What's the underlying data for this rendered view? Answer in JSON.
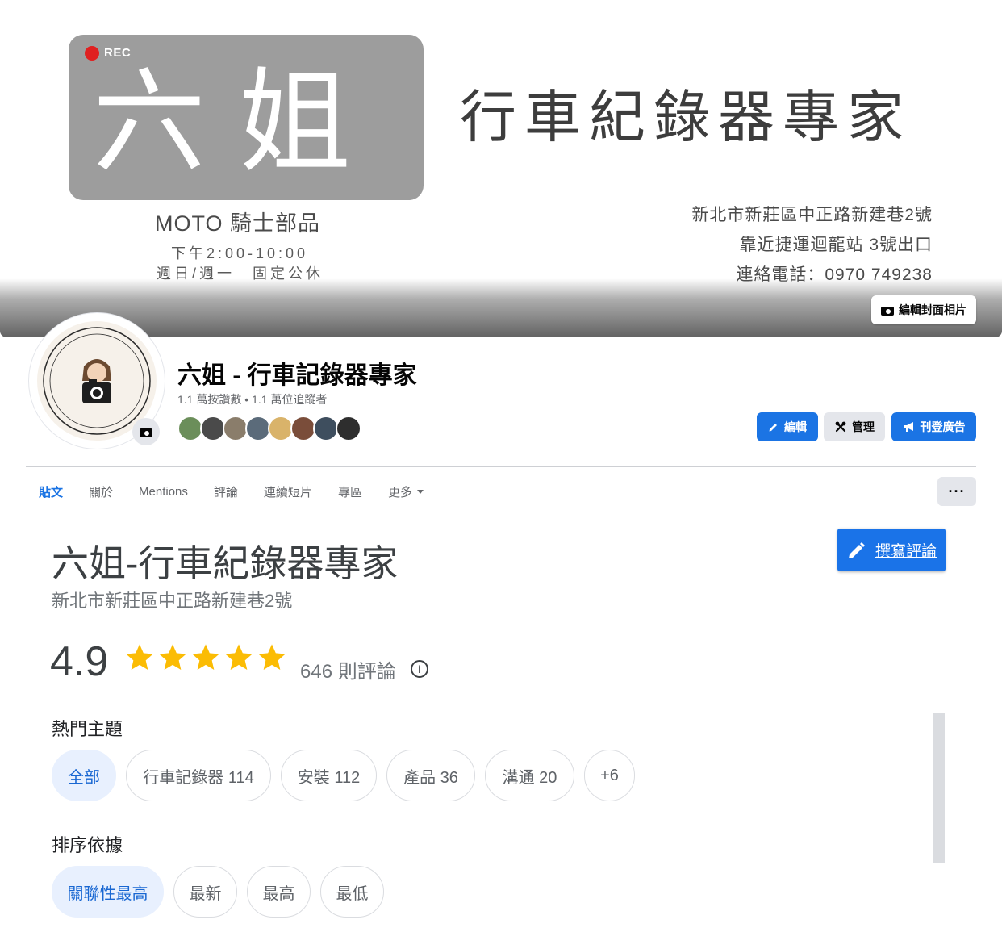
{
  "cover": {
    "rec_label": "REC",
    "logo_name": "六姐",
    "slogan": "行車紀錄器專家",
    "shop_type": "MOTO 騎士部品",
    "hours": "下午2:00-10:00",
    "closed": "週日/週一　固定公休",
    "address_line1": "新北市新莊區中正路新建巷2號",
    "address_line2": "靠近捷運迴龍站 3號出口",
    "address_line3": "連絡電話：0970 749238",
    "edit_cover_label": "編輯封面相片"
  },
  "profile": {
    "page_name": "六姐 - 行車記錄器專家",
    "stats": "1.1 萬按讚數 • 1.1 萬位追蹤者",
    "friend_avatar_colors": [
      "#6b8e5a",
      "#4a4a4a",
      "#8a7d6b",
      "#5b6b7a",
      "#d9b36a",
      "#7a4d3a",
      "#3e4e5e",
      "#2e2e2e"
    ]
  },
  "actions": {
    "edit_label": "編輯",
    "manage_label": "管理",
    "ads_label": "刊登廣告"
  },
  "tabs": [
    {
      "label": "貼文",
      "active": true
    },
    {
      "label": "關於",
      "active": false
    },
    {
      "label": "Mentions",
      "active": false
    },
    {
      "label": "評論",
      "active": false
    },
    {
      "label": "連續短片",
      "active": false
    },
    {
      "label": "專區",
      "active": false
    },
    {
      "label": "更多",
      "active": false
    }
  ],
  "more_button": "···",
  "reviews": {
    "title": "六姐-行車紀錄器專家",
    "address": "新北市新莊區中正路新建巷2號",
    "write_review_label": "撰寫評論",
    "rating": "4.9",
    "stars": 5,
    "review_count": "646 則評論",
    "topics_label": "熱門主題",
    "topics": [
      "全部",
      "行車記錄器  114",
      "安裝  112",
      "產品  36",
      "溝通  20",
      "+6"
    ],
    "sort_label": "排序依據",
    "sort_options": [
      "關聯性最高",
      "最新",
      "最高",
      "最低"
    ]
  },
  "colors": {
    "facebook_blue": "#1b74e4",
    "google_blue": "#1a73e8",
    "star_gold": "#fbbc04",
    "chip_selected_bg": "#e8f0fe"
  }
}
